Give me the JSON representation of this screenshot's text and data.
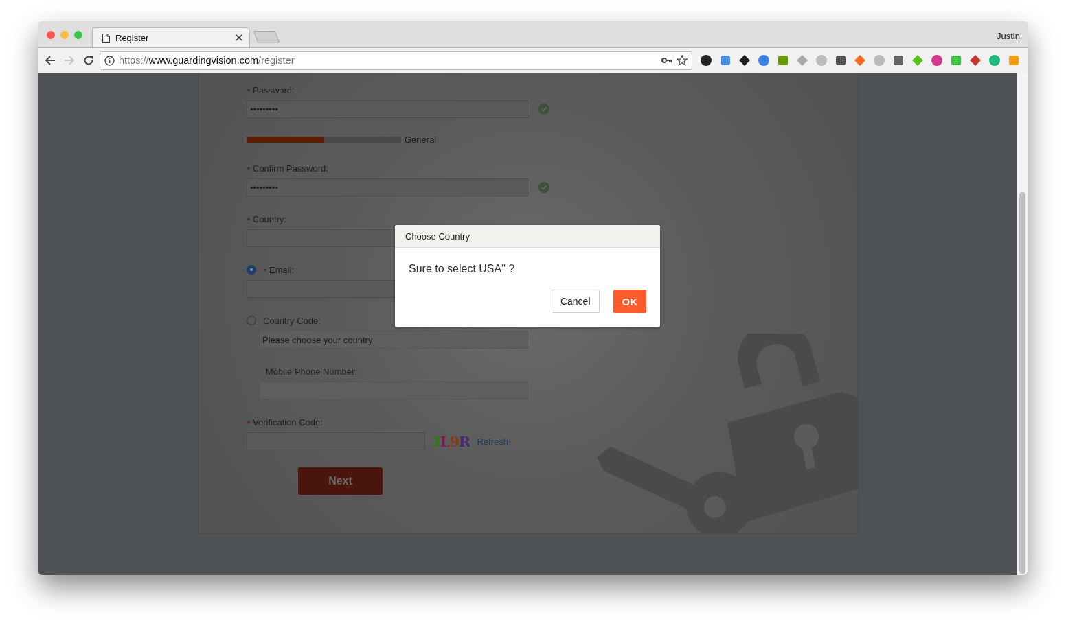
{
  "browser": {
    "tab": {
      "title": "Register"
    },
    "url": {
      "scheme": "https://",
      "host": "www.guardingvision.com",
      "path": "/register"
    },
    "profile": "Justin"
  },
  "form": {
    "fields": [
      {
        "kind": "input",
        "label": "Password:",
        "required": true,
        "value": "•••••••••",
        "valid": true,
        "disabled": false
      },
      {
        "kind": "strength",
        "level": 0.5,
        "label": "General"
      },
      {
        "kind": "input",
        "label": "Confirm Password:",
        "required": true,
        "value": "•••••••••",
        "valid": true,
        "disabled": false
      },
      {
        "kind": "input",
        "label": "Country:",
        "required": true,
        "valid": false,
        "disabled": false
      },
      {
        "kind": "choice",
        "label": "Email:",
        "required": true,
        "selected": true,
        "disabled": false
      },
      {
        "kind": "choice",
        "label": "Country Code:",
        "required": false,
        "selected": false,
        "disabled": true,
        "placeholder": "Please choose your country"
      },
      {
        "kind": "input",
        "label": "Mobile Phone Number:",
        "required": false,
        "valid": false,
        "disabled": true
      },
      {
        "kind": "captcha",
        "label": "Verification Code:",
        "required": true,
        "code": "3L9R",
        "link": "Refresh"
      }
    ],
    "submit": "Next"
  },
  "dialog": {
    "title": "Choose Country",
    "message": "Sure to select USA\" ?",
    "buttons": [
      {
        "label": "Cancel",
        "kind": "secondary"
      },
      {
        "label": "OK",
        "kind": "primary"
      }
    ]
  }
}
